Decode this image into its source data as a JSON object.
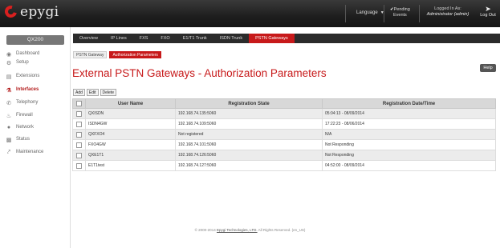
{
  "header": {
    "logo_text": "epygi",
    "language_label": "Language",
    "pending_label_1": "Pending",
    "pending_label_2": "Events",
    "logged_label": "Logged In As:",
    "logged_user": "Administrator (admin)",
    "logout_label": "Log Out"
  },
  "sidebar": {
    "title": "QX200",
    "items": [
      {
        "label": "Dashboard",
        "icon": "dashboard-icon"
      },
      {
        "label": "Setup",
        "icon": "gear-icon"
      },
      {
        "label": "Extensions",
        "icon": "extensions-icon"
      },
      {
        "label": "Interfaces",
        "icon": "interfaces-icon",
        "active": true
      },
      {
        "label": "Telephony",
        "icon": "phone-icon"
      },
      {
        "label": "Firewall",
        "icon": "flame-icon"
      },
      {
        "label": "Network",
        "icon": "globe-icon"
      },
      {
        "label": "Status",
        "icon": "chart-icon"
      },
      {
        "label": "Maintenance",
        "icon": "wrench-icon"
      }
    ]
  },
  "tabs": [
    "Overview",
    "IP Lines",
    "FXS",
    "FXO",
    "E1/T1 Trunk",
    "ISDN Trunk",
    "PSTN Gateways"
  ],
  "active_tab": "PSTN Gateways",
  "subtabs": [
    "PSTN Gateway",
    "Authorization Parameters"
  ],
  "active_subtab": "Authorization Parameters",
  "help_label": "Help",
  "page_title": "External PSTN Gateways - Authorization Parameters",
  "actions": {
    "add": "Add",
    "edit": "Edit",
    "delete": "Delete"
  },
  "table": {
    "columns": [
      "User Name",
      "Registration State",
      "Registration Date/Time"
    ],
    "rows": [
      [
        "QXISDN",
        "192.168.74.135:5060",
        "05:04:13 - 08/09/2014"
      ],
      [
        "ISDN4GW",
        "192.168.74.109:5060",
        "17:22:23 - 08/06/2014"
      ],
      [
        "QXFXO4",
        "Not registered",
        "N/A"
      ],
      [
        "FXO4GW",
        "192.168.74.101:5060",
        "Not Responding"
      ],
      [
        "QXE1T1",
        "192.168.74.126:5060",
        "Not Responding"
      ],
      [
        "E1T1test",
        "192.168.74.127:5060",
        "04:52:00 - 08/09/2014"
      ]
    ]
  },
  "footer": {
    "prefix": "© 2000-2014",
    "company": "Epygi Technologies, LTD.",
    "suffix": "All Rights Reserved. (en_US)"
  },
  "colors": {
    "accent": "#c7191a",
    "header_bg": "#1e1e1e",
    "tab_bar": "#2b2b2b"
  }
}
